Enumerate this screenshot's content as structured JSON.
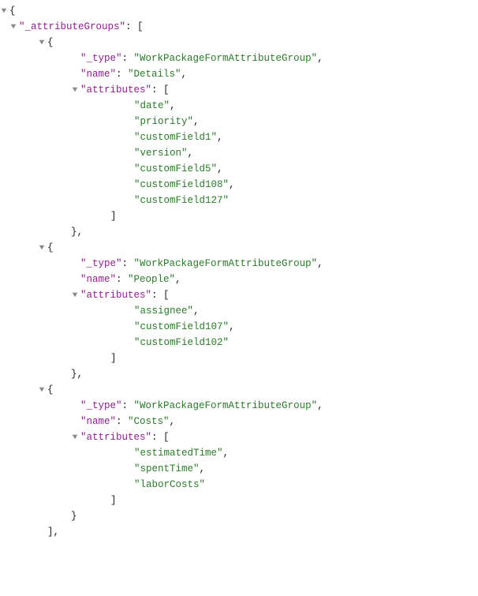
{
  "rootKey": "_attributeGroups",
  "groups": [
    {
      "typeKey": "_type",
      "typeVal": "WorkPackageFormAttributeGroup",
      "nameKey": "name",
      "nameVal": "Details",
      "attrKey": "attributes",
      "attributes": [
        "date",
        "priority",
        "customField1",
        "version",
        "customField5",
        "customField108",
        "customField127"
      ]
    },
    {
      "typeKey": "_type",
      "typeVal": "WorkPackageFormAttributeGroup",
      "nameKey": "name",
      "nameVal": "People",
      "attrKey": "attributes",
      "attributes": [
        "assignee",
        "customField107",
        "customField102"
      ]
    },
    {
      "typeKey": "_type",
      "typeVal": "WorkPackageFormAttributeGroup",
      "nameKey": "name",
      "nameVal": "Costs",
      "attrKey": "attributes",
      "attributes": [
        "estimatedTime",
        "spentTime",
        "laborCosts"
      ]
    }
  ]
}
